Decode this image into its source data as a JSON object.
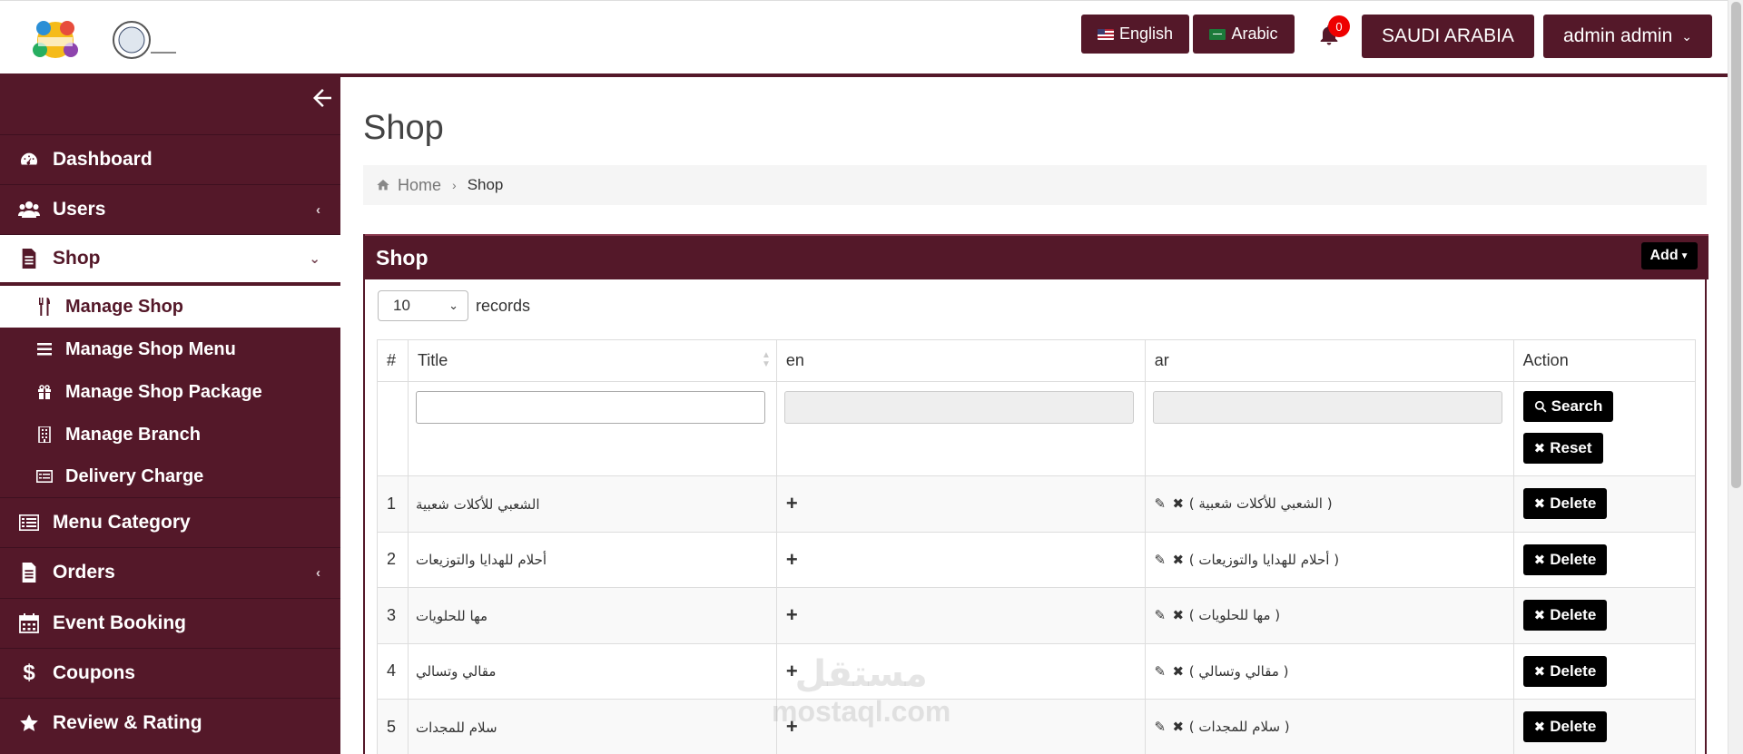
{
  "header": {
    "lang_en": "English",
    "lang_ar": "Arabic",
    "notification_count": "0",
    "country": "SAUDI ARABIA",
    "user": "admin admin"
  },
  "sidebar": {
    "items": [
      {
        "label": "Dashboard",
        "icon": "dashboard-icon"
      },
      {
        "label": "Users",
        "icon": "users-icon"
      },
      {
        "label": "Shop",
        "icon": "document-icon"
      },
      {
        "label": "Menu Category",
        "icon": "list-icon"
      },
      {
        "label": "Orders",
        "icon": "document-icon"
      },
      {
        "label": "Event Booking",
        "icon": "calendar-icon"
      },
      {
        "label": "Coupons",
        "icon": "dollar-icon"
      },
      {
        "label": "Review & Rating",
        "icon": "star-icon"
      }
    ],
    "shop_sub": [
      {
        "label": "Manage Shop",
        "icon": "cutlery-icon"
      },
      {
        "label": "Manage Shop Menu",
        "icon": "bars-icon"
      },
      {
        "label": "Manage Shop Package",
        "icon": "gift-icon"
      },
      {
        "label": "Manage Branch",
        "icon": "building-icon"
      },
      {
        "label": "Delivery Charge",
        "icon": "card-icon"
      }
    ]
  },
  "page": {
    "title": "Shop",
    "breadcrumb_home": "Home",
    "breadcrumb_current": "Shop"
  },
  "panel": {
    "title": "Shop",
    "add_label": "Add",
    "records_value": "10",
    "records_label": "records",
    "columns": [
      "#",
      "Title",
      "en",
      "ar",
      "Action"
    ],
    "search_label": "Search",
    "reset_label": "Reset",
    "delete_label": "Delete",
    "rows": [
      {
        "n": "1",
        "title": "الشعبي للأكلات شعبية",
        "ar": "( الشعبي للأكلات شعبية )"
      },
      {
        "n": "2",
        "title": "أحلام للهدايا والتوزيعات",
        "ar": "( أحلام للهدايا والتوزيعات )"
      },
      {
        "n": "3",
        "title": "مها للحلويات",
        "ar": "( مها للحلويات )"
      },
      {
        "n": "4",
        "title": "مقالي وتسالي",
        "ar": "( مقالي وتسالي )"
      },
      {
        "n": "5",
        "title": "سلام للمجدات",
        "ar": "( سلام للمجدات )"
      }
    ]
  },
  "watermark": {
    "line1": "مستقل",
    "line2": "mostaql.com"
  }
}
